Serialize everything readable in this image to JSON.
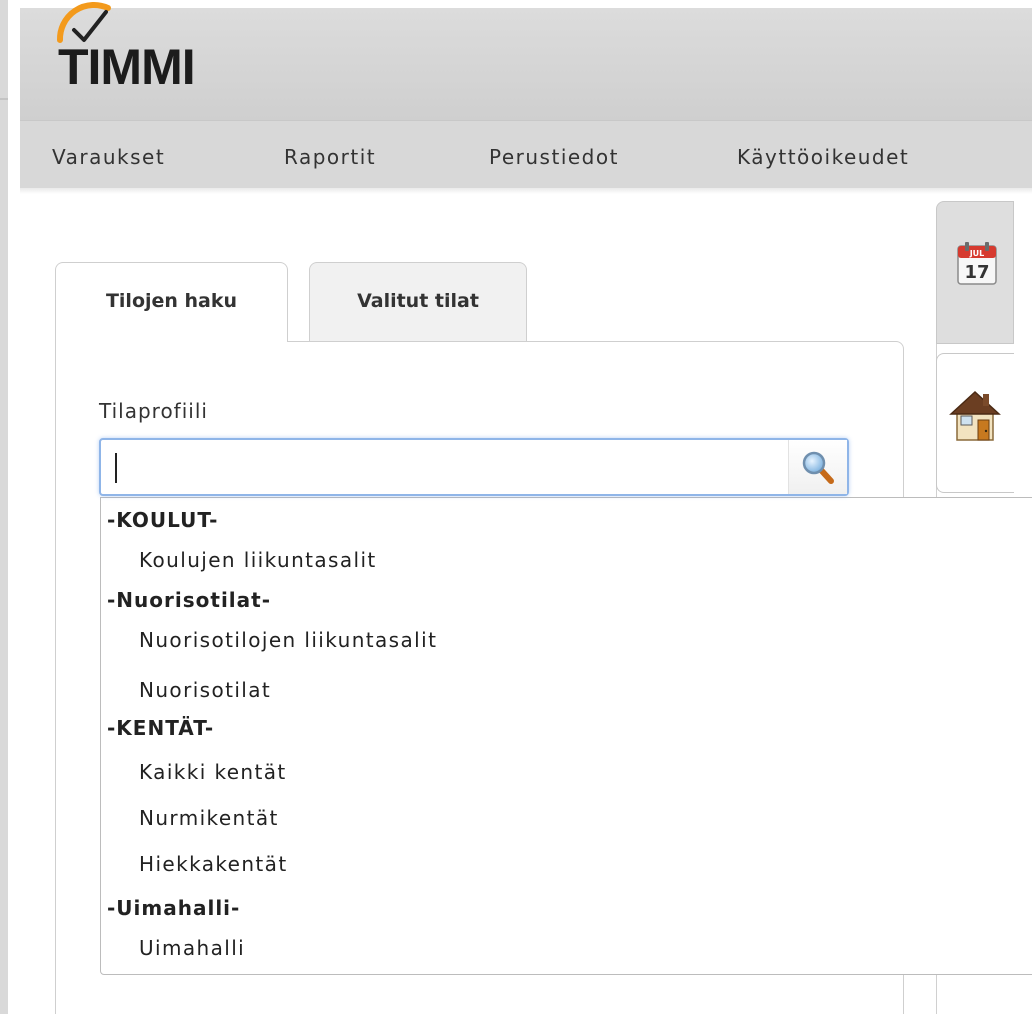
{
  "header": {
    "logo_text": "TIMMI"
  },
  "nav": {
    "items": [
      {
        "label": "Varaukset"
      },
      {
        "label": "Raportit"
      },
      {
        "label": "Perustiedot"
      },
      {
        "label": "Käyttöoikeudet"
      }
    ]
  },
  "tabs": [
    {
      "label": "Tilojen haku",
      "active": true
    },
    {
      "label": "Valitut tilat",
      "active": false
    }
  ],
  "search": {
    "label": "Tilaprofiili",
    "value": "",
    "button_icon": "magnifier-icon"
  },
  "dropdown": {
    "groups": [
      {
        "label": "-KOULUT-",
        "items": [
          "Koulujen liikuntasalit"
        ]
      },
      {
        "label": "-Nuorisotilat-",
        "items": [
          "Nuorisotilojen liikuntasalit",
          "Nuorisotilat"
        ]
      },
      {
        "label": "-KENTÄT-",
        "items": [
          "Kaikki kentät",
          "Nurmikentät",
          "Hiekkakentät"
        ]
      },
      {
        "label": "-Uimahalli-",
        "items": [
          "Uimahalli"
        ]
      }
    ]
  },
  "side_tabs": {
    "calendar": {
      "icon": "calendar-icon",
      "day": "17",
      "month": "JUL"
    },
    "home": {
      "icon": "house-icon"
    }
  },
  "colors": {
    "logo_accent": "#f39a1c",
    "focus_border": "#8fb5e8",
    "header_bg": "#d6d6d6"
  }
}
